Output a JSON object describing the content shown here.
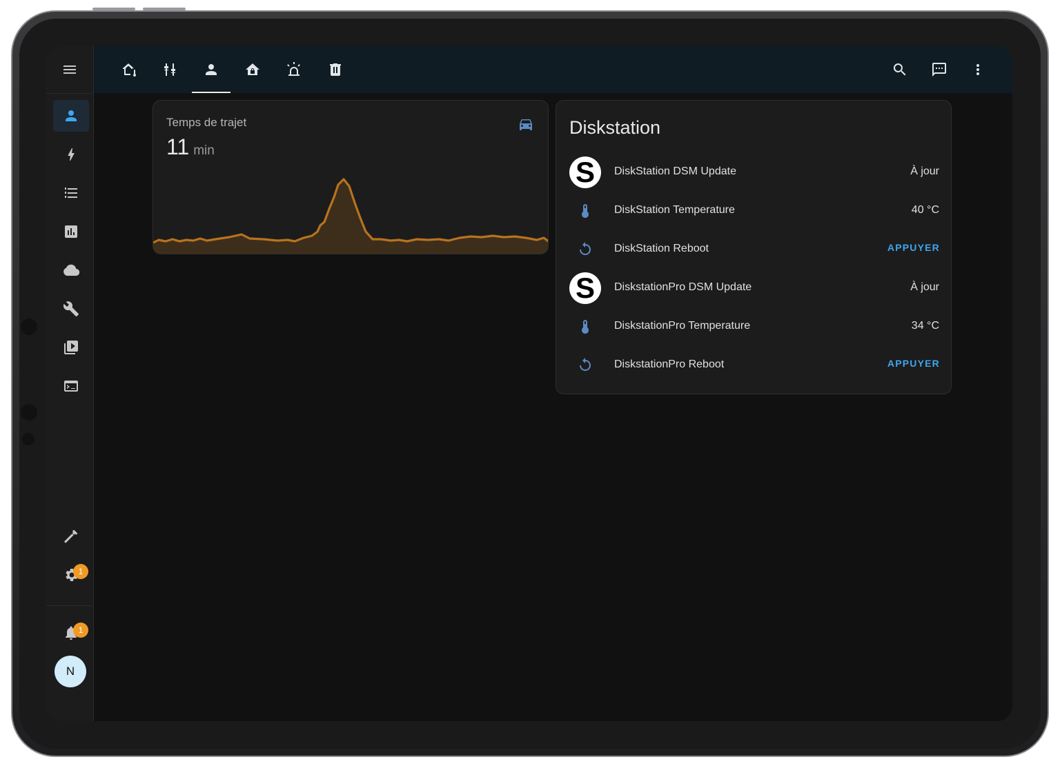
{
  "topbar": {
    "tabs": [
      {
        "icon": "home-thermometer-icon"
      },
      {
        "icon": "tune-sliders-icon"
      },
      {
        "icon": "person-icon",
        "active": true
      },
      {
        "icon": "home-lock-icon"
      },
      {
        "icon": "alarm-light-icon"
      },
      {
        "icon": "trash-icon"
      }
    ],
    "actions": [
      "search-icon",
      "assist-chat-icon",
      "more-vert-icon"
    ]
  },
  "sidebar": {
    "items": [
      {
        "icon": "person-icon",
        "active": true
      },
      {
        "icon": "lightning-icon"
      },
      {
        "icon": "list-icon"
      },
      {
        "icon": "chart-icon"
      },
      {
        "icon": "cloud-icon"
      },
      {
        "icon": "wrench-icon"
      },
      {
        "icon": "media-icon"
      },
      {
        "icon": "terminal-icon"
      }
    ],
    "developer_icon": "hammer-icon",
    "settings_badge": "1",
    "notifications_badge": "1",
    "avatar_initial": "N"
  },
  "travel_card": {
    "name": "Temps de trajet",
    "value": "11",
    "unit": "min",
    "icon": "car-icon",
    "color": "#b8731f"
  },
  "diskstation": {
    "title": "Diskstation",
    "rows": [
      {
        "icon": "synology-s-icon",
        "label": "DiskStation DSM Update",
        "state": "À jour"
      },
      {
        "icon": "thermometer-icon",
        "label": "DiskStation Temperature",
        "state": "40 °C"
      },
      {
        "icon": "restart-icon",
        "label": "DiskStation Reboot",
        "action": "APPUYER"
      },
      {
        "icon": "synology-s-icon",
        "label": "DiskstationPro DSM Update",
        "state": "À jour"
      },
      {
        "icon": "thermometer-icon",
        "label": "DiskstationPro Temperature",
        "state": "34 °C"
      },
      {
        "icon": "restart-icon",
        "label": "DiskstationPro Reboot",
        "action": "APPUYER"
      }
    ]
  }
}
